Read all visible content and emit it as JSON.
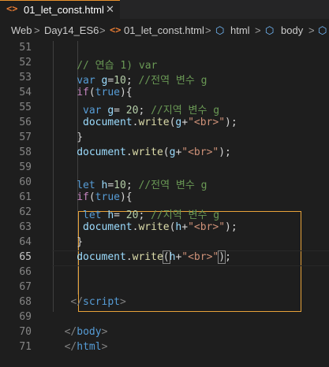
{
  "tab": {
    "icon": "html-tag-icon",
    "icon_glyph": "<>",
    "filename": "01_let_const.html",
    "close_glyph": "✕"
  },
  "breadcrumb": {
    "items": [
      "Web",
      "Day14_ES6",
      "01_let_const.html",
      "html",
      "body"
    ],
    "separator": ">",
    "file_icon_glyph": "<>",
    "element_icon_glyph": "⬡"
  },
  "editor": {
    "line_numbers": [
      "51",
      "52",
      "53",
      "54",
      "55",
      "56",
      "57",
      "58",
      "59",
      "60",
      "61",
      "62",
      "63",
      "64",
      "65",
      "66",
      "67",
      "68",
      "69",
      "70",
      "71"
    ],
    "active_line": "65",
    "lines": [
      [],
      [
        [
          "cmt",
          "// 연습 1) var"
        ]
      ],
      [
        [
          "kw",
          "var"
        ],
        [
          "pl",
          " "
        ],
        [
          "var",
          "g"
        ],
        [
          "pl",
          "="
        ],
        [
          "num",
          "10"
        ],
        [
          "pl",
          "; "
        ],
        [
          "cmt",
          "//전역 변수 g"
        ]
      ],
      [
        [
          "ctl",
          "if"
        ],
        [
          "pl",
          "("
        ],
        [
          "kw",
          "true"
        ],
        [
          "pl",
          "){"
        ]
      ],
      [
        [
          "kw",
          "var"
        ],
        [
          "pl",
          " "
        ],
        [
          "var",
          "g"
        ],
        [
          "pl",
          "= "
        ],
        [
          "num",
          "20"
        ],
        [
          "pl",
          "; "
        ],
        [
          "cmt",
          "//지역 변수 g"
        ]
      ],
      [
        [
          "var",
          "document"
        ],
        [
          "pl",
          "."
        ],
        [
          "fn",
          "write"
        ],
        [
          "pl",
          "("
        ],
        [
          "var",
          "g"
        ],
        [
          "pl",
          "+"
        ],
        [
          "str",
          "\"<br>\""
        ],
        [
          "pl",
          ");"
        ]
      ],
      [
        [
          "pl",
          "}"
        ]
      ],
      [
        [
          "var",
          "document"
        ],
        [
          "pl",
          "."
        ],
        [
          "fn",
          "write"
        ],
        [
          "pl",
          "("
        ],
        [
          "var",
          "g"
        ],
        [
          "pl",
          "+"
        ],
        [
          "str",
          "\"<br>\""
        ],
        [
          "pl",
          ");"
        ]
      ],
      [],
      [
        [
          "kw",
          "let"
        ],
        [
          "pl",
          " "
        ],
        [
          "var",
          "h"
        ],
        [
          "pl",
          "="
        ],
        [
          "num",
          "10"
        ],
        [
          "pl",
          "; "
        ],
        [
          "cmt",
          "//전역 변수 g"
        ]
      ],
      [
        [
          "ctl",
          "if"
        ],
        [
          "pl",
          "("
        ],
        [
          "kw",
          "true"
        ],
        [
          "pl",
          "){"
        ]
      ],
      [
        [
          "kw",
          "let"
        ],
        [
          "pl",
          " "
        ],
        [
          "var",
          "h"
        ],
        [
          "pl",
          "= "
        ],
        [
          "num",
          "20"
        ],
        [
          "pl",
          "; "
        ],
        [
          "cmt",
          "//지역 변수 g"
        ]
      ],
      [
        [
          "var",
          "document"
        ],
        [
          "pl",
          "."
        ],
        [
          "fn",
          "write"
        ],
        [
          "pl",
          "("
        ],
        [
          "var",
          "h"
        ],
        [
          "pl",
          "+"
        ],
        [
          "str",
          "\"<br>\""
        ],
        [
          "pl",
          ");"
        ]
      ],
      [
        [
          "pl",
          "}"
        ]
      ],
      [
        [
          "var",
          "document"
        ],
        [
          "pl",
          "."
        ],
        [
          "fn",
          "write"
        ],
        [
          "brk",
          "("
        ],
        [
          "var",
          "h"
        ],
        [
          "pl",
          "+"
        ],
        [
          "str",
          "\"<br>\""
        ],
        [
          "brk",
          ")"
        ],
        [
          "pl",
          ";"
        ]
      ],
      [],
      [],
      [
        [
          "tag",
          "</"
        ],
        [
          "tagn",
          "script"
        ],
        [
          "tag",
          ">"
        ]
      ],
      [],
      [
        [
          "tag",
          "</"
        ],
        [
          "tagn",
          "body"
        ],
        [
          "tag",
          ">"
        ]
      ],
      [
        [
          "tag",
          "</"
        ],
        [
          "tagn",
          "html"
        ],
        [
          "tag",
          ">"
        ]
      ]
    ]
  }
}
